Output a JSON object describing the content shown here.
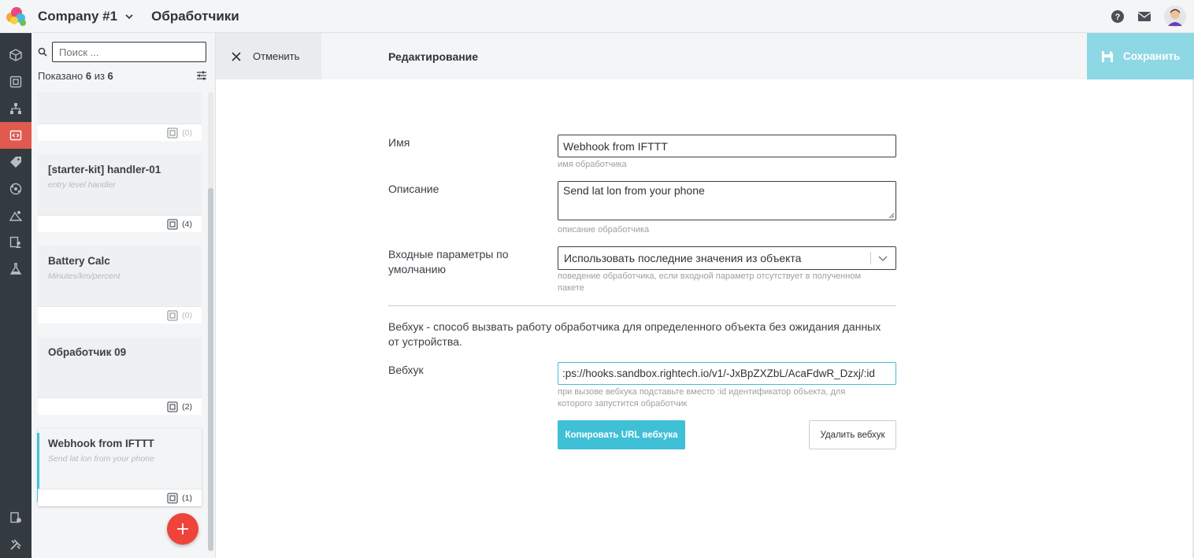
{
  "header": {
    "company": "Company #1",
    "section": "Обработчики"
  },
  "list": {
    "search_placeholder": "Поиск ...",
    "shown_prefix": "Показано ",
    "shown_count": "6",
    "shown_middle": " из ",
    "shown_total": "6",
    "items": [
      {
        "title": "",
        "desc": "",
        "count": "(0)"
      },
      {
        "title": "[starter-kit] handler-01",
        "desc": "entry level handler",
        "count": "(4)"
      },
      {
        "title": "Battery Calc",
        "desc": "Minutes/km/percent",
        "count": "(0)"
      },
      {
        "title": "Обработчик 09",
        "desc": "",
        "count": "(2)"
      },
      {
        "title": "Webhook from IFTTT",
        "desc": "Send lat lon from your phone",
        "count": "(1)"
      }
    ]
  },
  "edit": {
    "cancel_label": "Отменить",
    "title": "Редактирование",
    "save_label": "Сохранить"
  },
  "form": {
    "name_label": "Имя",
    "name_value": "Webhook from IFTTT",
    "name_hint": "имя обработчика",
    "desc_label": "Описание",
    "desc_value": "Send lat lon from your phone",
    "desc_hint": "описание обработчика",
    "params_label": "Входные параметры по умолчанию",
    "params_value": "Использовать последние значения из объекта",
    "params_hint": "поведение обработчика, если входной параметр отсутствует в полученном пакете",
    "webhook_intro": "Вебхук - способ вызвать работу обработчика для определенного объекта без ожидания данных от устройства.",
    "webhook_label": "Вебхук",
    "webhook_value": ":ps://hooks.sandbox.rightech.io/v1/-JxBpZXZbL/AcaFdwR_Dzxj/:id",
    "webhook_hint": "при вызове вебхука подставьте вместо :id идентификатор объекта, для которого запустится обработчик",
    "copy_label": "Копировать URL вебхука",
    "delete_label": "Удалить вебхук"
  },
  "colors": {
    "accent": "#3fc0d6",
    "rail": "#333a40",
    "rail_active": "#e05a50",
    "fab": "#f0433a"
  }
}
